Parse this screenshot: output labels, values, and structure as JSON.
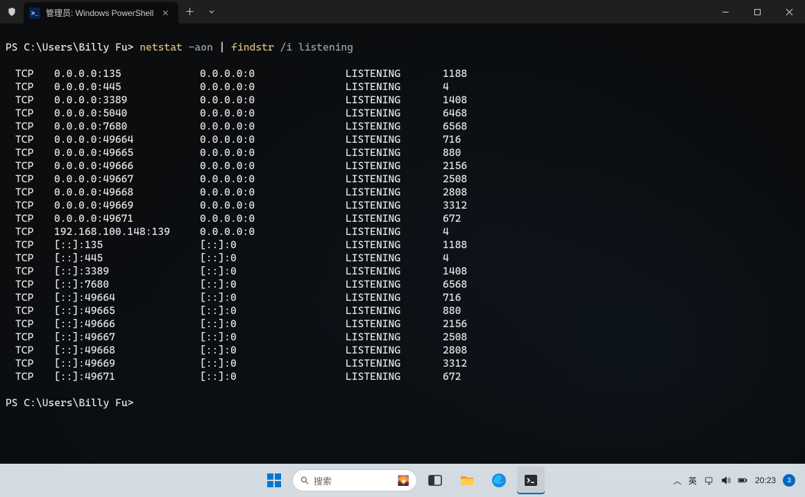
{
  "window": {
    "tab_title": "管理员: Windows PowerShell",
    "shield_alt": "admin-shield"
  },
  "prompt": {
    "prefix": "PS ",
    "path": "C:\\Users\\Billy Fu",
    "gt": "> ",
    "cmd1": "netstat",
    "arg1": " -aon ",
    "pipe": "|",
    "cmd2": " findstr",
    "arg2": " /i listening"
  },
  "columns": [
    "proto",
    "local",
    "foreign",
    "state",
    "pid"
  ],
  "rows": [
    {
      "proto": "TCP",
      "local": "0.0.0.0:135",
      "foreign": "0.0.0.0:0",
      "state": "LISTENING",
      "pid": "1188"
    },
    {
      "proto": "TCP",
      "local": "0.0.0.0:445",
      "foreign": "0.0.0.0:0",
      "state": "LISTENING",
      "pid": "4"
    },
    {
      "proto": "TCP",
      "local": "0.0.0.0:3389",
      "foreign": "0.0.0.0:0",
      "state": "LISTENING",
      "pid": "1408"
    },
    {
      "proto": "TCP",
      "local": "0.0.0.0:5040",
      "foreign": "0.0.0.0:0",
      "state": "LISTENING",
      "pid": "6468"
    },
    {
      "proto": "TCP",
      "local": "0.0.0.0:7680",
      "foreign": "0.0.0.0:0",
      "state": "LISTENING",
      "pid": "6568"
    },
    {
      "proto": "TCP",
      "local": "0.0.0.0:49664",
      "foreign": "0.0.0.0:0",
      "state": "LISTENING",
      "pid": "716"
    },
    {
      "proto": "TCP",
      "local": "0.0.0.0:49665",
      "foreign": "0.0.0.0:0",
      "state": "LISTENING",
      "pid": "880"
    },
    {
      "proto": "TCP",
      "local": "0.0.0.0:49666",
      "foreign": "0.0.0.0:0",
      "state": "LISTENING",
      "pid": "2156"
    },
    {
      "proto": "TCP",
      "local": "0.0.0.0:49667",
      "foreign": "0.0.0.0:0",
      "state": "LISTENING",
      "pid": "2508"
    },
    {
      "proto": "TCP",
      "local": "0.0.0.0:49668",
      "foreign": "0.0.0.0:0",
      "state": "LISTENING",
      "pid": "2808"
    },
    {
      "proto": "TCP",
      "local": "0.0.0.0:49669",
      "foreign": "0.0.0.0:0",
      "state": "LISTENING",
      "pid": "3312"
    },
    {
      "proto": "TCP",
      "local": "0.0.0.0:49671",
      "foreign": "0.0.0.0:0",
      "state": "LISTENING",
      "pid": "672"
    },
    {
      "proto": "TCP",
      "local": "192.168.100.148:139",
      "foreign": "0.0.0.0:0",
      "state": "LISTENING",
      "pid": "4"
    },
    {
      "proto": "TCP",
      "local": "[::]:135",
      "foreign": "[::]:0",
      "state": "LISTENING",
      "pid": "1188"
    },
    {
      "proto": "TCP",
      "local": "[::]:445",
      "foreign": "[::]:0",
      "state": "LISTENING",
      "pid": "4"
    },
    {
      "proto": "TCP",
      "local": "[::]:3389",
      "foreign": "[::]:0",
      "state": "LISTENING",
      "pid": "1408"
    },
    {
      "proto": "TCP",
      "local": "[::]:7680",
      "foreign": "[::]:0",
      "state": "LISTENING",
      "pid": "6568"
    },
    {
      "proto": "TCP",
      "local": "[::]:49664",
      "foreign": "[::]:0",
      "state": "LISTENING",
      "pid": "716"
    },
    {
      "proto": "TCP",
      "local": "[::]:49665",
      "foreign": "[::]:0",
      "state": "LISTENING",
      "pid": "880"
    },
    {
      "proto": "TCP",
      "local": "[::]:49666",
      "foreign": "[::]:0",
      "state": "LISTENING",
      "pid": "2156"
    },
    {
      "proto": "TCP",
      "local": "[::]:49667",
      "foreign": "[::]:0",
      "state": "LISTENING",
      "pid": "2508"
    },
    {
      "proto": "TCP",
      "local": "[::]:49668",
      "foreign": "[::]:0",
      "state": "LISTENING",
      "pid": "2808"
    },
    {
      "proto": "TCP",
      "local": "[::]:49669",
      "foreign": "[::]:0",
      "state": "LISTENING",
      "pid": "3312"
    },
    {
      "proto": "TCP",
      "local": "[::]:49671",
      "foreign": "[::]:0",
      "state": "LISTENING",
      "pid": "672"
    }
  ],
  "prompt2": "PS C:\\Users\\Billy Fu> ",
  "taskbar": {
    "search_placeholder": "搜索",
    "ime": "英",
    "clock": "20:23",
    "notif_count": "3"
  }
}
